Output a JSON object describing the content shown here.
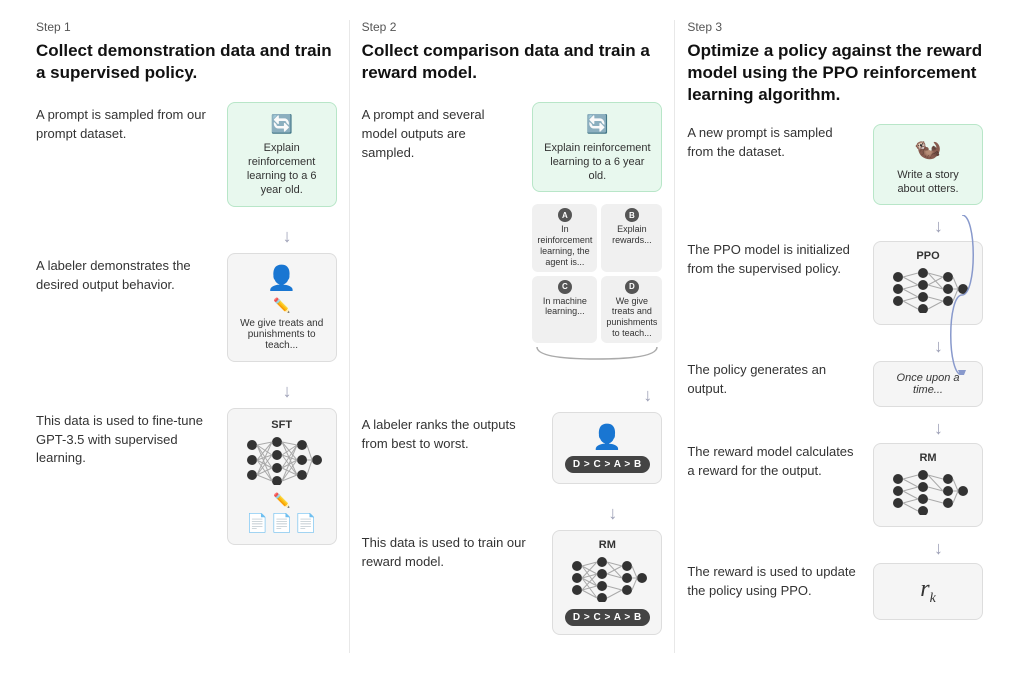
{
  "steps": [
    {
      "label": "Step 1",
      "title": "Collect demonstration data and train a supervised policy.",
      "sections": [
        {
          "id": "s1-prompt",
          "text": "A prompt is sampled from our prompt dataset.",
          "card_type": "prompt",
          "card_text": "Explain reinforcement learning to a 6 year old.",
          "card_icon": "🔄"
        },
        {
          "id": "s1-labeler",
          "text": "A labeler demonstrates the desired output behavior.",
          "card_type": "labeler",
          "card_text": "We give treats and punishments to teach...",
          "card_icon": "👤",
          "card_sub_icon": "✏️"
        },
        {
          "id": "s1-sft",
          "text": "This data is used to fine-tune GPT-3.5 with supervised learning.",
          "card_type": "sft",
          "card_label": "SFT"
        }
      ]
    },
    {
      "label": "Step 2",
      "title": "Collect comparison data and train a reward model.",
      "sections": [
        {
          "id": "s2-prompt",
          "text": "A prompt and several model outputs are sampled.",
          "card_type": "prompt_with_outputs",
          "card_text": "Explain reinforcement learning to a 6 year old.",
          "card_icon": "🔄",
          "outputs": [
            {
              "letter": "A",
              "text": "In reinforcement learning, the agent is..."
            },
            {
              "letter": "B",
              "text": "Explain rewards..."
            },
            {
              "letter": "C",
              "text": "In machine learning..."
            },
            {
              "letter": "D",
              "text": "We give treats and punishments to teach..."
            }
          ]
        },
        {
          "id": "s2-rank",
          "text": "A labeler ranks the outputs from best to worst.",
          "card_type": "ranked",
          "sequence": "D > C > A > B"
        },
        {
          "id": "s2-rm",
          "text": "This data is used to train our reward model.",
          "card_type": "rm",
          "card_label": "RM",
          "sequence": "D > C > A > B"
        }
      ]
    },
    {
      "label": "Step 3",
      "title": "Optimize a policy against the reward model using the PPO reinforcement learning algorithm.",
      "sections": [
        {
          "id": "s3-prompt",
          "text": "A new prompt is sampled from the dataset.",
          "card_type": "prompt_otter",
          "card_text": "Write a story about otters.",
          "card_icon": "🦦"
        },
        {
          "id": "s3-ppo",
          "text": "The PPO model is initialized from the supervised policy.",
          "card_type": "ppo",
          "card_label": "PPO"
        },
        {
          "id": "s3-output",
          "text": "The policy generates an output.",
          "card_type": "text_output",
          "card_text": "Once upon a time..."
        },
        {
          "id": "s3-rm",
          "text": "The reward model calculates a reward for the output.",
          "card_type": "rm2",
          "card_label": "RM"
        },
        {
          "id": "s3-update",
          "text": "The reward is used to update the policy using PPO.",
          "card_type": "reward",
          "card_text": "r_k"
        }
      ]
    }
  ]
}
